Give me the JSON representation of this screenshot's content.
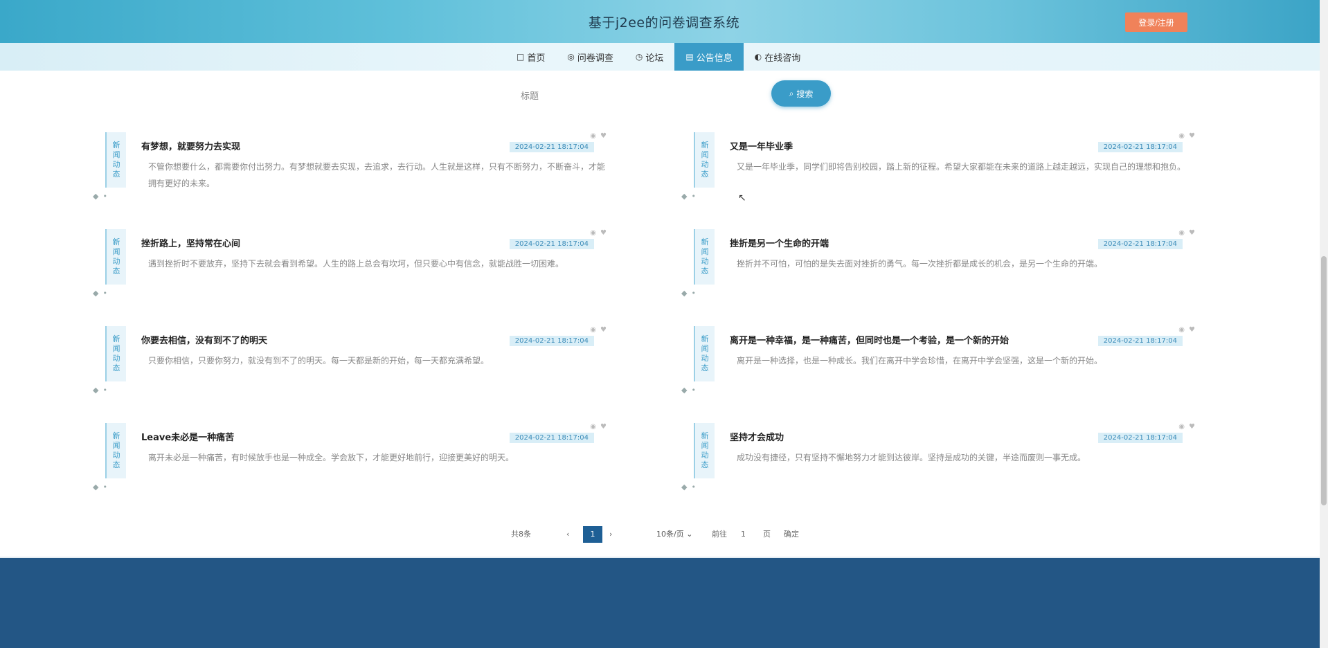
{
  "header": {
    "title": "基于j2ee的问卷调查系统",
    "login_button": "登录/注册"
  },
  "nav": {
    "items": [
      {
        "icon": "□",
        "label": "首页"
      },
      {
        "icon": "◎",
        "label": "问卷调查"
      },
      {
        "icon": "◷",
        "label": "论坛"
      },
      {
        "icon": "▤",
        "label": "公告信息"
      },
      {
        "icon": "◐",
        "label": "在线咨询"
      }
    ],
    "active_index": 3
  },
  "search": {
    "label": "标题",
    "placeholder": "",
    "button_label": "搜索",
    "button_icon": "search-icon"
  },
  "news": {
    "tag_chars": [
      "新",
      "闻",
      "动",
      "态"
    ],
    "items": [
      {
        "title": "有梦想，就要努力去实现",
        "date": "2024-02-21 18:17:04",
        "body": "不管你想要什么，都需要你付出努力。有梦想就要去实现，去追求，去行动。人生就是这样，只有不断努力，不断奋斗，才能拥有更好的未来。"
      },
      {
        "title": "又是一年毕业季",
        "date": "2024-02-21 18:17:04",
        "body": "又是一年毕业季，同学们即将告别校园，踏上新的征程。希望大家都能在未来的道路上越走越远，实现自己的理想和抱负。"
      },
      {
        "title": "挫折路上，坚持常在心间",
        "date": "2024-02-21 18:17:04",
        "body": "遇到挫折时不要放弃，坚持下去就会看到希望。人生的路上总会有坎坷，但只要心中有信念，就能战胜一切困难。"
      },
      {
        "title": "挫折是另一个生命的开端",
        "date": "2024-02-21 18:17:04",
        "body": "挫折并不可怕，可怕的是失去面对挫折的勇气。每一次挫折都是成长的机会，是另一个生命的开端。"
      },
      {
        "title": "你要去相信，没有到不了的明天",
        "date": "2024-02-21 18:17:04",
        "body": "只要你相信，只要你努力，就没有到不了的明天。每一天都是新的开始，每一天都充满希望。"
      },
      {
        "title": "离开是一种幸福，是一种痛苦，但同时也是一个考验，是一个新的开始",
        "date": "2024-02-21 18:17:04",
        "body": "离开是一种选择，也是一种成长。我们在离开中学会珍惜，在离开中学会坚强，这是一个新的开始。"
      },
      {
        "title": "Leave未必是一种痛苦",
        "date": "2024-02-21 18:17:04",
        "body": "离开未必是一种痛苦，有时候放手也是一种成全。学会放下，才能更好地前行，迎接更美好的明天。"
      },
      {
        "title": "坚持才会成功",
        "date": "2024-02-21 18:17:04",
        "body": "成功没有捷径，只有坚持不懈地努力才能到达彼岸。坚持是成功的关键，半途而废则一事无成。"
      }
    ]
  },
  "pagination": {
    "total": "共8条",
    "prev": "‹",
    "current": "1",
    "next": "›",
    "page_size": "10条/页",
    "goto_label": "前往",
    "goto_value": "1",
    "page_suffix": "页",
    "confirm": "确定"
  }
}
